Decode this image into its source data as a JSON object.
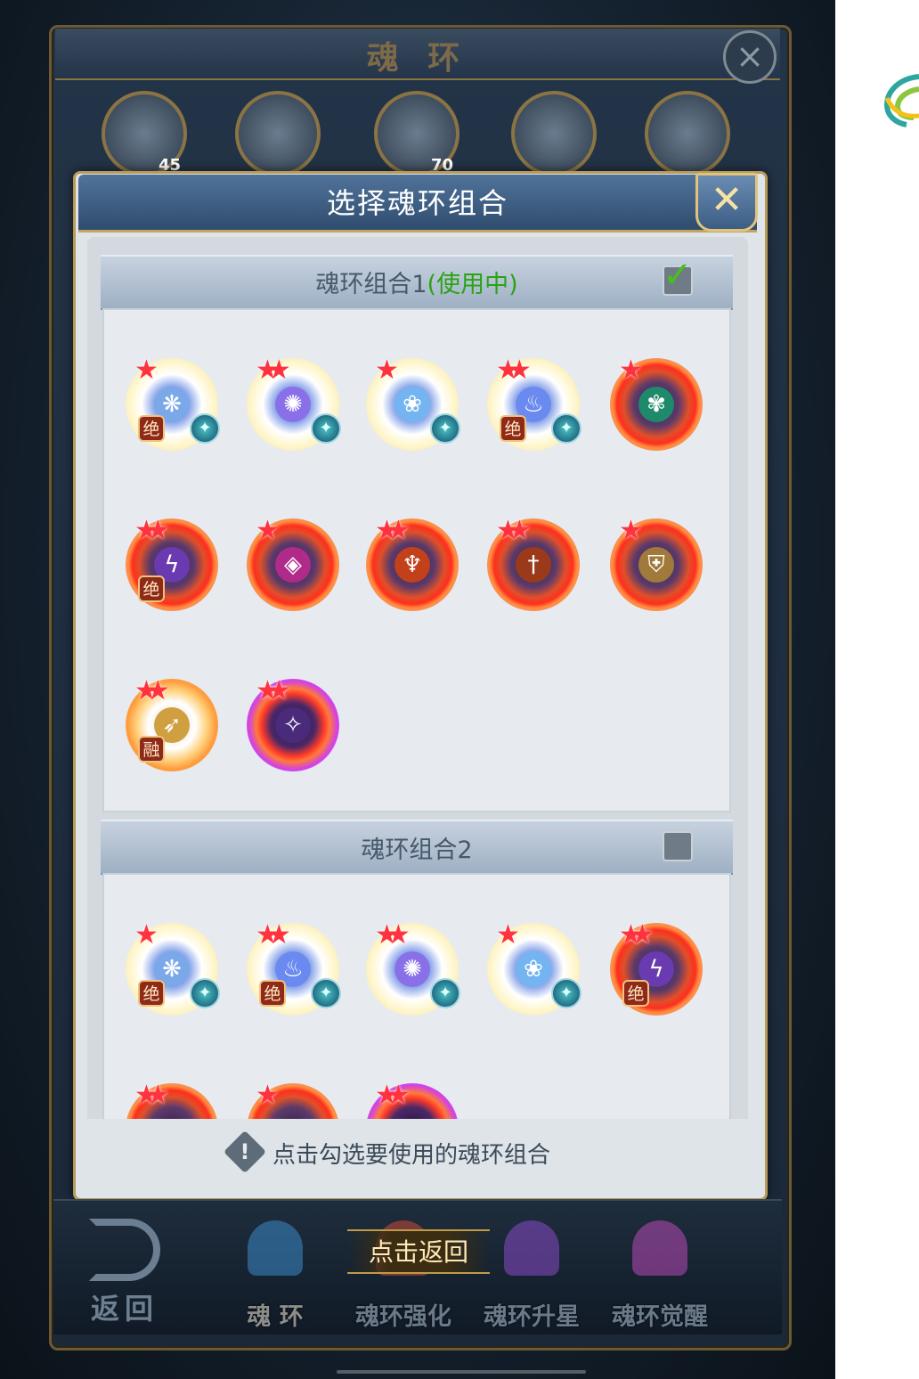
{
  "background_window": {
    "title": "魂 环",
    "close_icon": "×",
    "portraits": [
      {
        "level": "45"
      },
      {
        "level": ""
      },
      {
        "level": "70"
      },
      {
        "level": ""
      },
      {
        "level": ""
      }
    ]
  },
  "dialog": {
    "title": "选择魂环组合",
    "close_icon": "✕",
    "group1": {
      "label": "魂环组合1",
      "status": "(使用中)",
      "checked": true
    },
    "group2": {
      "label": "魂环组合2",
      "checked": false
    },
    "hint_icon": "!",
    "hint": "点击勾选要使用的魂环组合"
  },
  "rings": {
    "jue_badge": "绝",
    "rong_badge": "融",
    "element_icon": "✦"
  },
  "bottom_bar": {
    "back_label": "返回",
    "click_back": "点击返回",
    "tabs": [
      "魂 环",
      "魂环强化",
      "魂环升星",
      "魂环觉醒"
    ]
  },
  "colors": {
    "dialog_header": "#3a5a80",
    "active_status": "#2aa314",
    "gold_border": "#b89a58",
    "star": "#ff3340"
  }
}
